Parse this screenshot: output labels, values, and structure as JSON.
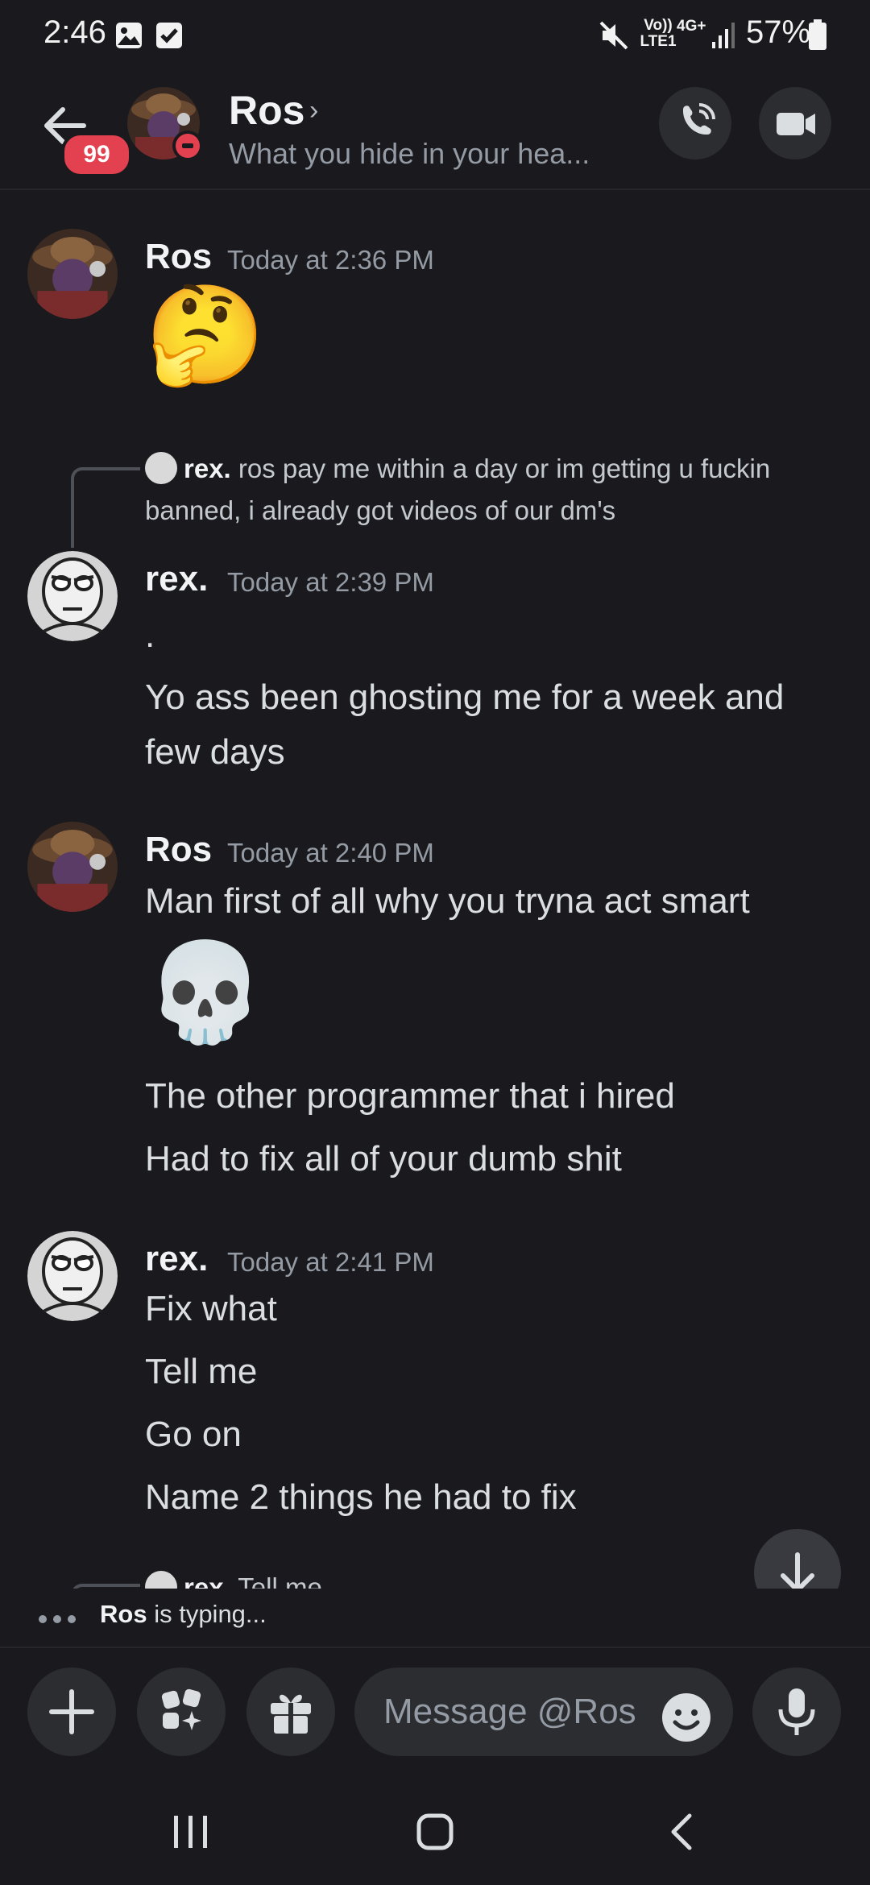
{
  "status_bar": {
    "time": "2:46",
    "network": "Vo)) LTE1",
    "network_type": "4G+",
    "battery": "57%",
    "icons": [
      "gallery-icon",
      "checkbox-icon",
      "mute-icon",
      "signal-icon",
      "battery-icon"
    ]
  },
  "header": {
    "back_icon": "arrow-left-icon",
    "badge": "99",
    "name": "Ros",
    "chevron": "›",
    "status_text": "What you hide in your hea...",
    "call_icon": "phone-icon",
    "video_icon": "video-camera-icon"
  },
  "messages": [
    {
      "author": "Ros",
      "time": "Today at 2:36 PM",
      "lines": [
        "🤔"
      ]
    },
    {
      "reply": {
        "author": "rex.",
        "text": "ros pay me within a day or im getting u fuckin banned, i already got videos of our dm's"
      },
      "author": "rex.",
      "time": "Today at 2:39 PM",
      "lines": [
        ".",
        "Yo ass been ghosting me for a week and few days"
      ]
    },
    {
      "author": "Ros",
      "time": "Today at 2:40 PM",
      "lines": [
        "Man first of all why you tryna act smart",
        "💀",
        "The other programmer that i hired",
        "Had to fix all of your dumb shit"
      ]
    },
    {
      "author": "rex.",
      "time": "Today at 2:41 PM",
      "lines": [
        "Fix what",
        "Tell me",
        "Go on",
        "Name 2 things he had to fix"
      ]
    },
    {
      "reply_partial": {
        "author": "rex.",
        "text": "Tell me"
      }
    }
  ],
  "typing": {
    "user": "Ros",
    "text": "is typing..."
  },
  "input_bar": {
    "placeholder": "Message @Ros",
    "buttons": [
      "plus-icon",
      "apps-icon",
      "gift-icon",
      "emoji-icon",
      "microphone-icon"
    ]
  },
  "colors": {
    "background": "#1a1a1e",
    "badge": "#e34050",
    "muted": "#949ba4"
  }
}
